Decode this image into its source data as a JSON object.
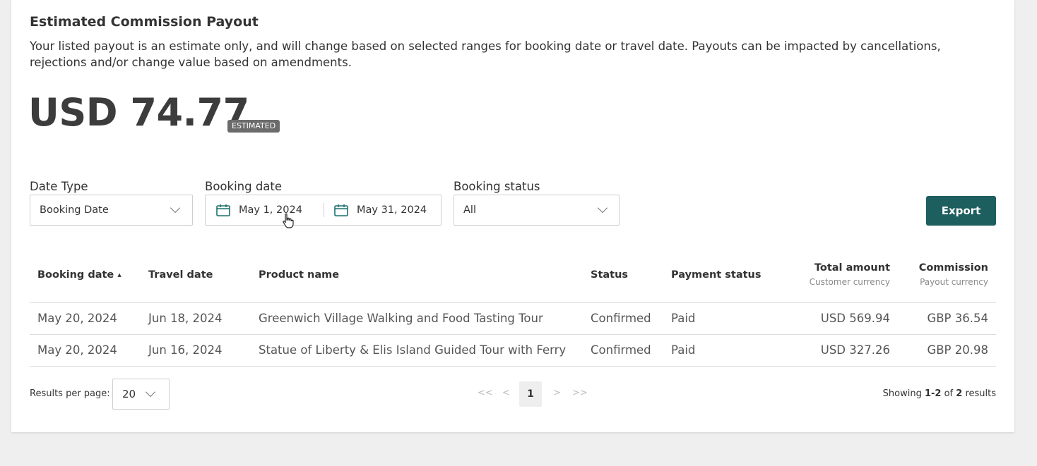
{
  "header": {
    "title": "Estimated Commission Payout",
    "description": "Your listed payout is an estimate only, and will change based on selected ranges for booking date or travel date. Payouts can be impacted by cancellations, rejections and/or change value based on amendments.",
    "amount": "USD 74.77",
    "badge": "ESTIMATED"
  },
  "filters": {
    "date_type": {
      "label": "Date Type",
      "value": "Booking Date"
    },
    "booking_date": {
      "label": "Booking date",
      "start": "May 1, 2024",
      "end": "May 31, 2024"
    },
    "booking_status": {
      "label": "Booking status",
      "value": "All"
    },
    "export_label": "Export"
  },
  "table": {
    "headers": {
      "booking_date": "Booking date",
      "sort_indicator": "▲",
      "travel_date": "Travel date",
      "product_name": "Product name",
      "status": "Status",
      "payment_status": "Payment status",
      "total_amount": "Total amount",
      "total_amount_sub": "Customer currency",
      "commission": "Commission",
      "commission_sub": "Payout currency"
    },
    "rows": [
      {
        "booking_date": "May 20, 2024",
        "travel_date": "Jun 18, 2024",
        "product_name": "Greenwich Village Walking and Food Tasting Tour",
        "status": "Confirmed",
        "payment_status": "Paid",
        "total_amount": "USD 569.94",
        "commission": "GBP 36.54"
      },
      {
        "booking_date": "May 20, 2024",
        "travel_date": "Jun 16, 2024",
        "product_name": "Statue of Liberty & Elis Island Guided Tour with Ferry",
        "status": "Confirmed",
        "payment_status": "Paid",
        "total_amount": "USD 327.26",
        "commission": "GBP 20.98"
      }
    ]
  },
  "footer": {
    "results_per_page_label": "Results per page:",
    "results_per_page_value": "20",
    "pagination": {
      "first": "<<",
      "prev": "<",
      "current": "1",
      "next": ">",
      "last": ">>"
    },
    "showing_prefix": "Showing ",
    "showing_range": "1-2",
    "showing_of": " of ",
    "showing_total": "2",
    "showing_suffix": " results"
  },
  "colors": {
    "accent": "#1d5e5e",
    "badge_bg": "#6b6b6b",
    "calendar_icon": "#1d6f6f"
  }
}
